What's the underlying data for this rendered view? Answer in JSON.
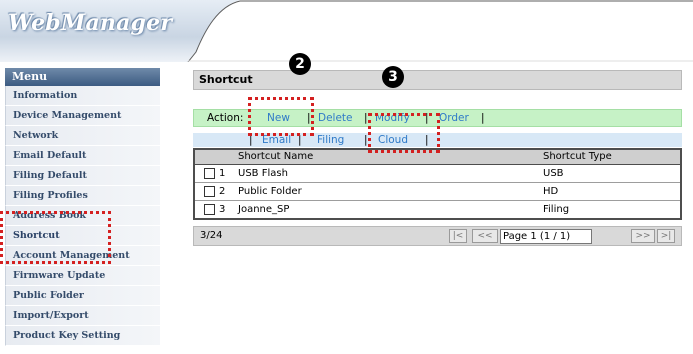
{
  "app": {
    "title": "WebManager"
  },
  "menu": {
    "header": "Menu",
    "items": [
      "Information",
      "Device Management",
      "Network",
      "Email Default",
      "Filing Default",
      "Filing Profiles",
      "Address Book",
      "Shortcut",
      "Account Management",
      "Firmware Update",
      "Public Folder",
      "Import/Export",
      "Product Key Setting"
    ],
    "active": "Shortcut"
  },
  "panel": {
    "title": "Shortcut"
  },
  "actions": {
    "label": "Action:",
    "new": "New",
    "delete": "Delete",
    "modify": "Modify",
    "order": "Order",
    "separator": "|"
  },
  "filters": {
    "email": "Email",
    "filing": "Filing",
    "cloud": "Cloud",
    "separator": "|"
  },
  "table": {
    "columns": [
      "Shortcut Name",
      "Shortcut Type"
    ],
    "rows": [
      {
        "num": "1",
        "name": "USB Flash",
        "type": "USB"
      },
      {
        "num": "2",
        "name": "Public Folder",
        "type": "HD"
      },
      {
        "num": "3",
        "name": "Joanne_SP",
        "type": "Filing"
      }
    ]
  },
  "pager": {
    "count": "3/24",
    "first": "|<",
    "prev": "<<",
    "page": "Page 1 (1 / 1)",
    "next": ">>",
    "last": ">|"
  },
  "annotations": {
    "badge2": "2",
    "badge3": "3",
    "color": "#d42020"
  }
}
